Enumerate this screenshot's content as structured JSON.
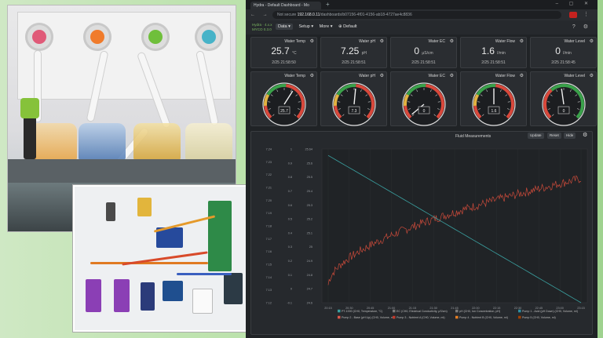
{
  "browser": {
    "tab_title": "Hydra - Default Dashboard - Mo",
    "tab_plus": "+",
    "window_buttons": "–  ▢  ✕",
    "nav": "← → ⟳",
    "security": "Not secure",
    "url_host": "192.168.0.11",
    "url_path": "/dashboards/b07156-4f01-4156-ab18-4727ae4c8836",
    "menu": "⋮"
  },
  "app": {
    "brand_line1": "Hydra · 4.x.x",
    "brand_line2": "MYCO 0.3.0",
    "menu": [
      "Data ▾",
      "Setup ▾",
      "More ▾",
      "⊕ Default"
    ],
    "head_icons": "?  ⚙"
  },
  "value_cards": [
    {
      "title": "Water Temp",
      "value": "25.7",
      "unit": "°C",
      "time": "2/25 21:58:50"
    },
    {
      "title": "Water pH",
      "value": "7.25",
      "unit": "pH",
      "time": "2/25 21:58:51"
    },
    {
      "title": "Water EC",
      "value": "0",
      "unit": "μS/cm",
      "time": "2/25 21:58:51"
    },
    {
      "title": "Water Flow",
      "value": "1.6",
      "unit": "l/min",
      "time": "2/25 21:58:51"
    },
    {
      "title": "Water Level",
      "value": "0",
      "unit": "l/min",
      "time": "2/25 21:58:45"
    }
  ],
  "gauge_cards": [
    {
      "title": "Water Temp",
      "readout": "25.7",
      "level": 0.62
    },
    {
      "title": "Water pH",
      "readout": "7.3",
      "level": 0.52
    },
    {
      "title": "Water EC",
      "readout": "0",
      "level": 0.02
    },
    {
      "title": "Water Flow",
      "readout": "1.6",
      "level": 0.5
    },
    {
      "title": "Water Level",
      "readout": "0",
      "level": 0.47
    }
  ],
  "chart": {
    "title": "Fluid Measurements",
    "buttons": [
      "Update",
      "Reset",
      "Hide"
    ],
    "gear": "⚙",
    "legend": [
      {
        "label": "PT-1000 (CH0, Temperature, °C)",
        "color": "#3aa0a0"
      },
      {
        "label": "EC (CH0, Electrical Conductivity, μS/cm)",
        "color": "#7a7a7a"
      },
      {
        "label": "pH (CH0, Ion Concentration, pH)",
        "color": "#7a7a7a"
      },
      {
        "label": "Pump 1 - Acid (pH Down) (CH0, Volume, ml)",
        "color": "#2e8fa3"
      },
      {
        "label": "Pump 2 - Base (pH Up) (CH0, Volume, ml)",
        "color": "#d9574a"
      },
      {
        "label": "Pump 3 - Nutrient A (CH0, Volume, ml)",
        "color": "#c0392b"
      },
      {
        "label": "Pump 4 - Nutrient B (CH0, Volume, ml)",
        "color": "#e67e22"
      },
      {
        "label": "Pump 5 (CH0, Volume, ml)",
        "color": "#a04000"
      }
    ]
  },
  "chart_data": {
    "type": "line",
    "x": [
      "20:15",
      "20:30",
      "20:45",
      "21:00",
      "21:15",
      "21:30",
      "21:45",
      "22:00",
      "22:15",
      "22:30",
      "22:45",
      "23:00",
      "23:15"
    ],
    "yaxes": [
      {
        "ticks": [
          "7.24",
          "7.23",
          "7.22",
          "7.21",
          "7.20",
          "7.19",
          "7.18",
          "7.17",
          "7.16",
          "7.15",
          "7.14",
          "7.13",
          "7.12"
        ]
      },
      {
        "ticks": [
          "1",
          "0.9",
          "0.8",
          "0.7",
          "0.6",
          "0.5",
          "0.4",
          "0.3",
          "0.2",
          "0.1",
          "0",
          "-0.1"
        ]
      },
      {
        "ticks": [
          "25.64",
          "25.6",
          "25.5",
          "25.4",
          "25.3",
          "25.2",
          "25.1",
          "25",
          "24.9",
          "24.8",
          "24.7",
          "24.6"
        ]
      }
    ],
    "series": [
      {
        "name": "PT-1000 (CH0, Temperature, °C)",
        "color": "#c94a3a",
        "y_start": 25.55,
        "y_end": 24.59
      },
      {
        "name": "pH (CH0, Ion Concentration, pH)",
        "color": "#3aa0a0",
        "y_start": 7.235,
        "y_end": 7.12
      }
    ]
  }
}
